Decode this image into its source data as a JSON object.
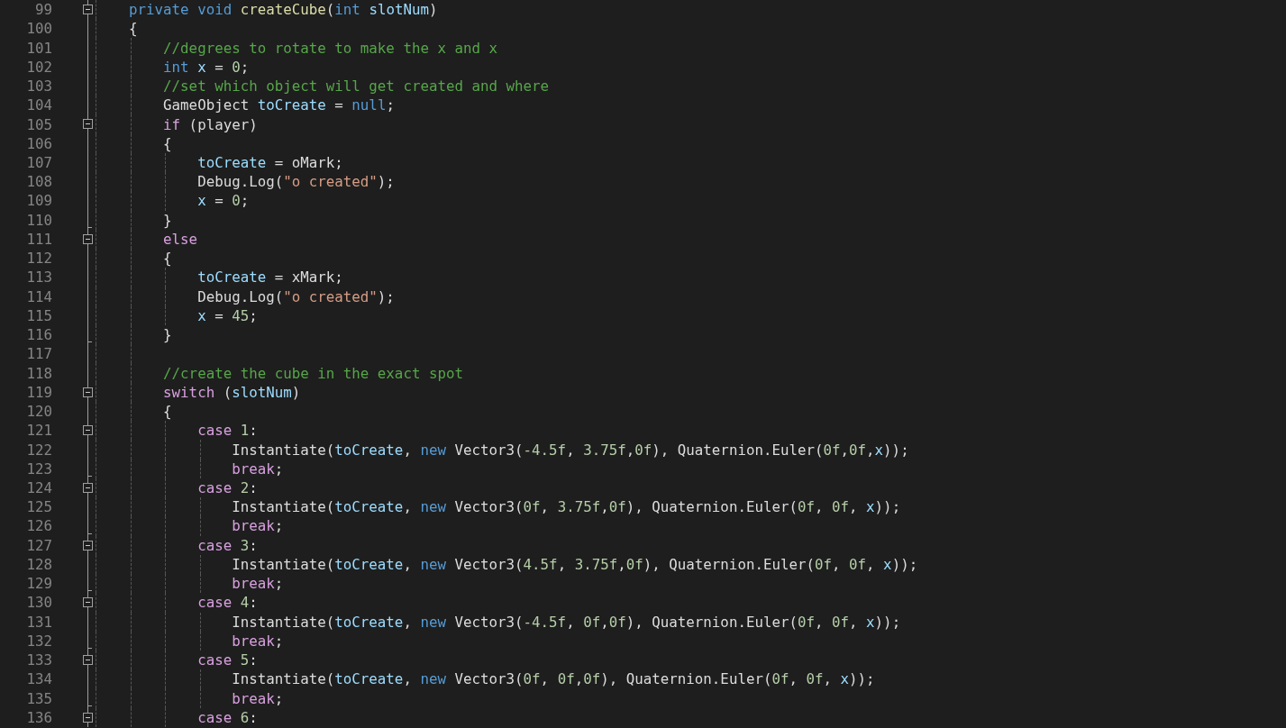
{
  "editor": {
    "lines": [
      {
        "number": "99",
        "kind": "fold-start",
        "tokens": [
          {
            "kind": "kw",
            "text": "    private "
          },
          {
            "kind": "kw",
            "text": "void "
          },
          {
            "kind": "fn",
            "text": "createCube"
          },
          {
            "kind": "p",
            "text": "("
          },
          {
            "kind": "kw",
            "text": "int "
          },
          {
            "kind": "var",
            "text": "slotNum"
          },
          {
            "kind": "p",
            "text": ")"
          }
        ]
      },
      {
        "number": "100",
        "kind": "fold-body",
        "tokens": [
          {
            "kind": "p",
            "text": "    {"
          }
        ]
      },
      {
        "number": "101",
        "kind": "fold-body",
        "tokens": [
          {
            "kind": "cm",
            "text": "        //degrees to rotate to make the x and x"
          }
        ]
      },
      {
        "number": "102",
        "kind": "fold-body",
        "tokens": [
          {
            "kind": "kw",
            "text": "        int "
          },
          {
            "kind": "var",
            "text": "x"
          },
          {
            "kind": "p",
            "text": " = "
          },
          {
            "kind": "num",
            "text": "0"
          },
          {
            "kind": "p",
            "text": ";"
          }
        ]
      },
      {
        "number": "103",
        "kind": "fold-body",
        "tokens": [
          {
            "kind": "cm",
            "text": "        //set which object will get created and where"
          }
        ]
      },
      {
        "number": "104",
        "kind": "fold-body",
        "tokens": [
          {
            "kind": "p",
            "text": "        GameObject "
          },
          {
            "kind": "var",
            "text": "toCreate"
          },
          {
            "kind": "p",
            "text": " = "
          },
          {
            "kind": "kw",
            "text": "null"
          },
          {
            "kind": "p",
            "text": ";"
          }
        ]
      },
      {
        "number": "105",
        "kind": "fold-start",
        "tokens": [
          {
            "kind": "ctl",
            "text": "        if"
          },
          {
            "kind": "p",
            "text": " (player)"
          }
        ]
      },
      {
        "number": "106",
        "kind": "fold-body",
        "tokens": [
          {
            "kind": "p",
            "text": "        {"
          }
        ]
      },
      {
        "number": "107",
        "kind": "fold-body",
        "tokens": [
          {
            "kind": "var",
            "text": "            toCreate"
          },
          {
            "kind": "p",
            "text": " = oMark;"
          }
        ]
      },
      {
        "number": "108",
        "kind": "fold-body",
        "tokens": [
          {
            "kind": "p",
            "text": "            Debug.Log("
          },
          {
            "kind": "str",
            "text": "\"o created\""
          },
          {
            "kind": "p",
            "text": ");"
          }
        ]
      },
      {
        "number": "109",
        "kind": "fold-body",
        "tokens": [
          {
            "kind": "var",
            "text": "            x"
          },
          {
            "kind": "p",
            "text": " = "
          },
          {
            "kind": "num",
            "text": "0"
          },
          {
            "kind": "p",
            "text": ";"
          }
        ]
      },
      {
        "number": "110",
        "kind": "fold-end",
        "tokens": [
          {
            "kind": "p",
            "text": "        }"
          }
        ]
      },
      {
        "number": "111",
        "kind": "fold-start",
        "tokens": [
          {
            "kind": "ctl",
            "text": "        else"
          }
        ]
      },
      {
        "number": "112",
        "kind": "fold-body",
        "tokens": [
          {
            "kind": "p",
            "text": "        {"
          }
        ]
      },
      {
        "number": "113",
        "kind": "fold-body",
        "tokens": [
          {
            "kind": "var",
            "text": "            toCreate"
          },
          {
            "kind": "p",
            "text": " = xMark;"
          }
        ]
      },
      {
        "number": "114",
        "kind": "fold-body",
        "tokens": [
          {
            "kind": "p",
            "text": "            Debug.Log("
          },
          {
            "kind": "str",
            "text": "\"o created\""
          },
          {
            "kind": "p",
            "text": ");"
          }
        ]
      },
      {
        "number": "115",
        "kind": "fold-body",
        "tokens": [
          {
            "kind": "var",
            "text": "            x"
          },
          {
            "kind": "p",
            "text": " = "
          },
          {
            "kind": "num",
            "text": "45"
          },
          {
            "kind": "p",
            "text": ";"
          }
        ]
      },
      {
        "number": "116",
        "kind": "fold-end",
        "tokens": [
          {
            "kind": "p",
            "text": "        }"
          }
        ]
      },
      {
        "number": "117",
        "kind": "fold-body"
      },
      {
        "number": "118",
        "kind": "fold-body",
        "tokens": [
          {
            "kind": "cm",
            "text": "        //create the cube in the exact spot"
          }
        ]
      },
      {
        "number": "119",
        "kind": "fold-start",
        "tokens": [
          {
            "kind": "ctl",
            "text": "        switch"
          },
          {
            "kind": "p",
            "text": " ("
          },
          {
            "kind": "var",
            "text": "slotNum"
          },
          {
            "kind": "p",
            "text": ")"
          }
        ]
      },
      {
        "number": "120",
        "kind": "fold-body",
        "tokens": [
          {
            "kind": "p",
            "text": "        {"
          }
        ]
      },
      {
        "number": "121",
        "kind": "fold-start",
        "tokens": [
          {
            "kind": "ctl",
            "text": "            case "
          },
          {
            "kind": "num",
            "text": "1"
          },
          {
            "kind": "p",
            "text": ":"
          }
        ]
      },
      {
        "number": "122",
        "kind": "fold-body",
        "tokens": [
          {
            "kind": "p",
            "text": "                Instantiate("
          },
          {
            "kind": "var",
            "text": "toCreate"
          },
          {
            "kind": "p",
            "text": ", "
          },
          {
            "kind": "kw",
            "text": "new"
          },
          {
            "kind": "p",
            "text": " Vector3("
          },
          {
            "kind": "num",
            "text": "-4.5f"
          },
          {
            "kind": "p",
            "text": ", "
          },
          {
            "kind": "num",
            "text": "3.75f"
          },
          {
            "kind": "p",
            "text": ","
          },
          {
            "kind": "num",
            "text": "0f"
          },
          {
            "kind": "p",
            "text": "), Quaternion.Euler("
          },
          {
            "kind": "num",
            "text": "0f"
          },
          {
            "kind": "p",
            "text": ","
          },
          {
            "kind": "num",
            "text": "0f"
          },
          {
            "kind": "p",
            "text": ","
          },
          {
            "kind": "var",
            "text": "x"
          },
          {
            "kind": "p",
            "text": "));"
          }
        ]
      },
      {
        "number": "123",
        "kind": "fold-end",
        "tokens": [
          {
            "kind": "ctl",
            "text": "                break"
          },
          {
            "kind": "p",
            "text": ";"
          }
        ]
      },
      {
        "number": "124",
        "kind": "fold-start",
        "tokens": [
          {
            "kind": "ctl",
            "text": "            case "
          },
          {
            "kind": "num",
            "text": "2"
          },
          {
            "kind": "p",
            "text": ":"
          }
        ]
      },
      {
        "number": "125",
        "kind": "fold-body",
        "tokens": [
          {
            "kind": "p",
            "text": "                Instantiate("
          },
          {
            "kind": "var",
            "text": "toCreate"
          },
          {
            "kind": "p",
            "text": ", "
          },
          {
            "kind": "kw",
            "text": "new"
          },
          {
            "kind": "p",
            "text": " Vector3("
          },
          {
            "kind": "num",
            "text": "0f"
          },
          {
            "kind": "p",
            "text": ", "
          },
          {
            "kind": "num",
            "text": "3.75f"
          },
          {
            "kind": "p",
            "text": ","
          },
          {
            "kind": "num",
            "text": "0f"
          },
          {
            "kind": "p",
            "text": "), Quaternion.Euler("
          },
          {
            "kind": "num",
            "text": "0f"
          },
          {
            "kind": "p",
            "text": ", "
          },
          {
            "kind": "num",
            "text": "0f"
          },
          {
            "kind": "p",
            "text": ", "
          },
          {
            "kind": "var",
            "text": "x"
          },
          {
            "kind": "p",
            "text": "));"
          }
        ]
      },
      {
        "number": "126",
        "kind": "fold-end",
        "tokens": [
          {
            "kind": "ctl",
            "text": "                break"
          },
          {
            "kind": "p",
            "text": ";"
          }
        ]
      },
      {
        "number": "127",
        "kind": "fold-start",
        "tokens": [
          {
            "kind": "ctl",
            "text": "            case "
          },
          {
            "kind": "num",
            "text": "3"
          },
          {
            "kind": "p",
            "text": ":"
          }
        ]
      },
      {
        "number": "128",
        "kind": "fold-body",
        "tokens": [
          {
            "kind": "p",
            "text": "                Instantiate("
          },
          {
            "kind": "var",
            "text": "toCreate"
          },
          {
            "kind": "p",
            "text": ", "
          },
          {
            "kind": "kw",
            "text": "new"
          },
          {
            "kind": "p",
            "text": " Vector3("
          },
          {
            "kind": "num",
            "text": "4.5f"
          },
          {
            "kind": "p",
            "text": ", "
          },
          {
            "kind": "num",
            "text": "3.75f"
          },
          {
            "kind": "p",
            "text": ","
          },
          {
            "kind": "num",
            "text": "0f"
          },
          {
            "kind": "p",
            "text": "), Quaternion.Euler("
          },
          {
            "kind": "num",
            "text": "0f"
          },
          {
            "kind": "p",
            "text": ", "
          },
          {
            "kind": "num",
            "text": "0f"
          },
          {
            "kind": "p",
            "text": ", "
          },
          {
            "kind": "var",
            "text": "x"
          },
          {
            "kind": "p",
            "text": "));"
          }
        ]
      },
      {
        "number": "129",
        "kind": "fold-end",
        "tokens": [
          {
            "kind": "ctl",
            "text": "                break"
          },
          {
            "kind": "p",
            "text": ";"
          }
        ]
      },
      {
        "number": "130",
        "kind": "fold-start",
        "tokens": [
          {
            "kind": "ctl",
            "text": "            case "
          },
          {
            "kind": "num",
            "text": "4"
          },
          {
            "kind": "p",
            "text": ":"
          }
        ]
      },
      {
        "number": "131",
        "kind": "fold-body",
        "tokens": [
          {
            "kind": "p",
            "text": "                Instantiate("
          },
          {
            "kind": "var",
            "text": "toCreate"
          },
          {
            "kind": "p",
            "text": ", "
          },
          {
            "kind": "kw",
            "text": "new"
          },
          {
            "kind": "p",
            "text": " Vector3("
          },
          {
            "kind": "num",
            "text": "-4.5f"
          },
          {
            "kind": "p",
            "text": ", "
          },
          {
            "kind": "num",
            "text": "0f"
          },
          {
            "kind": "p",
            "text": ","
          },
          {
            "kind": "num",
            "text": "0f"
          },
          {
            "kind": "p",
            "text": "), Quaternion.Euler("
          },
          {
            "kind": "num",
            "text": "0f"
          },
          {
            "kind": "p",
            "text": ", "
          },
          {
            "kind": "num",
            "text": "0f"
          },
          {
            "kind": "p",
            "text": ", "
          },
          {
            "kind": "var",
            "text": "x"
          },
          {
            "kind": "p",
            "text": "));"
          }
        ]
      },
      {
        "number": "132",
        "kind": "fold-end",
        "tokens": [
          {
            "kind": "ctl",
            "text": "                break"
          },
          {
            "kind": "p",
            "text": ";"
          }
        ]
      },
      {
        "number": "133",
        "kind": "fold-start",
        "tokens": [
          {
            "kind": "ctl",
            "text": "            case "
          },
          {
            "kind": "num",
            "text": "5"
          },
          {
            "kind": "p",
            "text": ":"
          }
        ]
      },
      {
        "number": "134",
        "kind": "fold-body",
        "tokens": [
          {
            "kind": "p",
            "text": "                Instantiate("
          },
          {
            "kind": "var",
            "text": "toCreate"
          },
          {
            "kind": "p",
            "text": ", "
          },
          {
            "kind": "kw",
            "text": "new"
          },
          {
            "kind": "p",
            "text": " Vector3("
          },
          {
            "kind": "num",
            "text": "0f"
          },
          {
            "kind": "p",
            "text": ", "
          },
          {
            "kind": "num",
            "text": "0f"
          },
          {
            "kind": "p",
            "text": ","
          },
          {
            "kind": "num",
            "text": "0f"
          },
          {
            "kind": "p",
            "text": "), Quaternion.Euler("
          },
          {
            "kind": "num",
            "text": "0f"
          },
          {
            "kind": "p",
            "text": ", "
          },
          {
            "kind": "num",
            "text": "0f"
          },
          {
            "kind": "p",
            "text": ", "
          },
          {
            "kind": "var",
            "text": "x"
          },
          {
            "kind": "p",
            "text": "));"
          }
        ]
      },
      {
        "number": "135",
        "kind": "fold-end",
        "tokens": [
          {
            "kind": "ctl",
            "text": "                break"
          },
          {
            "kind": "p",
            "text": ";"
          }
        ]
      },
      {
        "number": "136",
        "kind": "fold-start",
        "tokens": [
          {
            "kind": "ctl",
            "text": "            case "
          },
          {
            "kind": "num",
            "text": "6"
          },
          {
            "kind": "p",
            "text": ":"
          }
        ]
      }
    ]
  }
}
